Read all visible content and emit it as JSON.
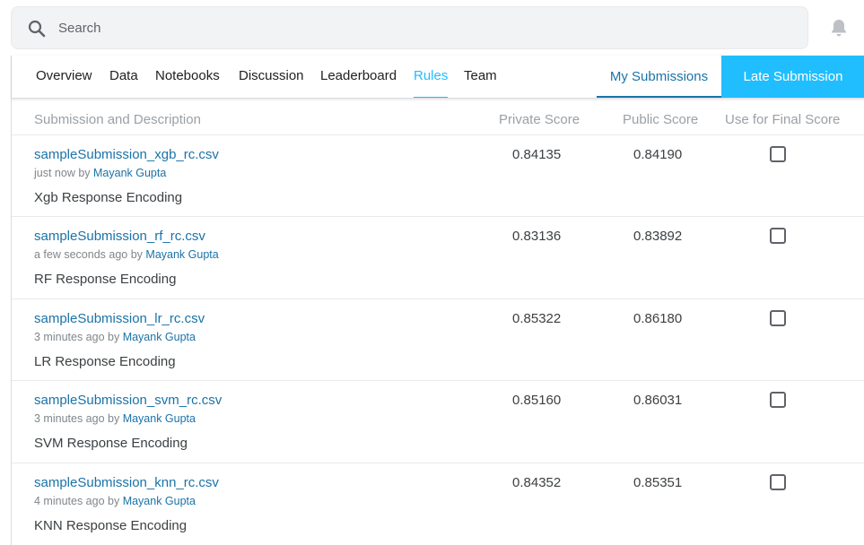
{
  "search": {
    "placeholder": "Search"
  },
  "tabs": [
    {
      "label": "Overview"
    },
    {
      "label": "Data"
    },
    {
      "label": "Notebooks"
    },
    {
      "label": "Discussion"
    },
    {
      "label": "Leaderboard"
    },
    {
      "label": "Rules"
    },
    {
      "label": "Team"
    }
  ],
  "active_tab": "Rules",
  "my_submissions_label": "My Submissions",
  "late_submission_label": "Late Submission",
  "columns": {
    "description": "Submission and Description",
    "private": "Private Score",
    "public": "Public Score",
    "final": "Use for Final Score"
  },
  "submissions": [
    {
      "file": "sampleSubmission_xgb_rc.csv",
      "time": "just now by",
      "author": "Mayank Gupta",
      "description": "Xgb Response Encoding",
      "private": "0.84135",
      "public": "0.84190",
      "final": false
    },
    {
      "file": "sampleSubmission_rf_rc.csv",
      "time": "a few seconds ago by",
      "author": "Mayank Gupta",
      "description": "RF Response Encoding",
      "private": "0.83136",
      "public": "0.83892",
      "final": false
    },
    {
      "file": "sampleSubmission_lr_rc.csv",
      "time": "3 minutes ago by",
      "author": "Mayank Gupta",
      "description": "LR Response Encoding",
      "private": "0.85322",
      "public": "0.86180",
      "final": false
    },
    {
      "file": "sampleSubmission_svm_rc.csv",
      "time": "3 minutes ago by",
      "author": "Mayank Gupta",
      "description": "SVM Response Encoding",
      "private": "0.85160",
      "public": "0.86031",
      "final": false
    },
    {
      "file": "sampleSubmission_knn_rc.csv",
      "time": "4 minutes ago by",
      "author": "Mayank Gupta",
      "description": "KNN Response Encoding",
      "private": "0.84352",
      "public": "0.85351",
      "final": false
    }
  ]
}
